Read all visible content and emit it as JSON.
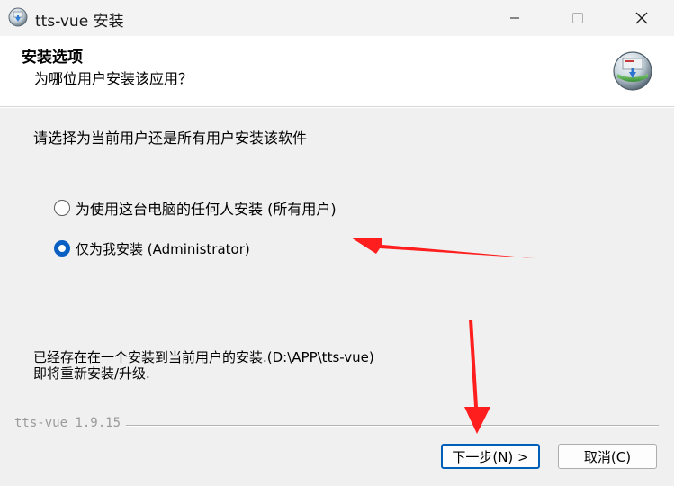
{
  "window": {
    "title": "tts-vue 安装"
  },
  "header": {
    "title": "安装选项",
    "subtitle": "为哪位用户安装该应用？"
  },
  "body": {
    "prompt": "请选择为当前用户还是所有用户安装该软件",
    "options": [
      {
        "label": "为使用这台电脑的任何人安装 (所有用户)",
        "selected": false
      },
      {
        "label": "仅为我安装 (Administrator)",
        "selected": true
      }
    ],
    "notice_line1": "已经存在在一个安装到当前用户的安装.(D:\\APP\\tts-vue)",
    "notice_line2": "即将重新安装/升级."
  },
  "footer": {
    "brand": "tts-vue 1.9.15",
    "next_label": "下一步(N) >",
    "cancel_label": "取消(C)"
  },
  "colors": {
    "accent": "#005fb8",
    "radio_checked": "#0a5fc2",
    "annotation_arrow": "#ff1e1e"
  },
  "icons": {
    "app": "installer-app-icon",
    "header_logo": "installer-globe-logo-icon",
    "minimize": "minimize-icon",
    "maximize": "maximize-icon",
    "close": "close-icon"
  }
}
